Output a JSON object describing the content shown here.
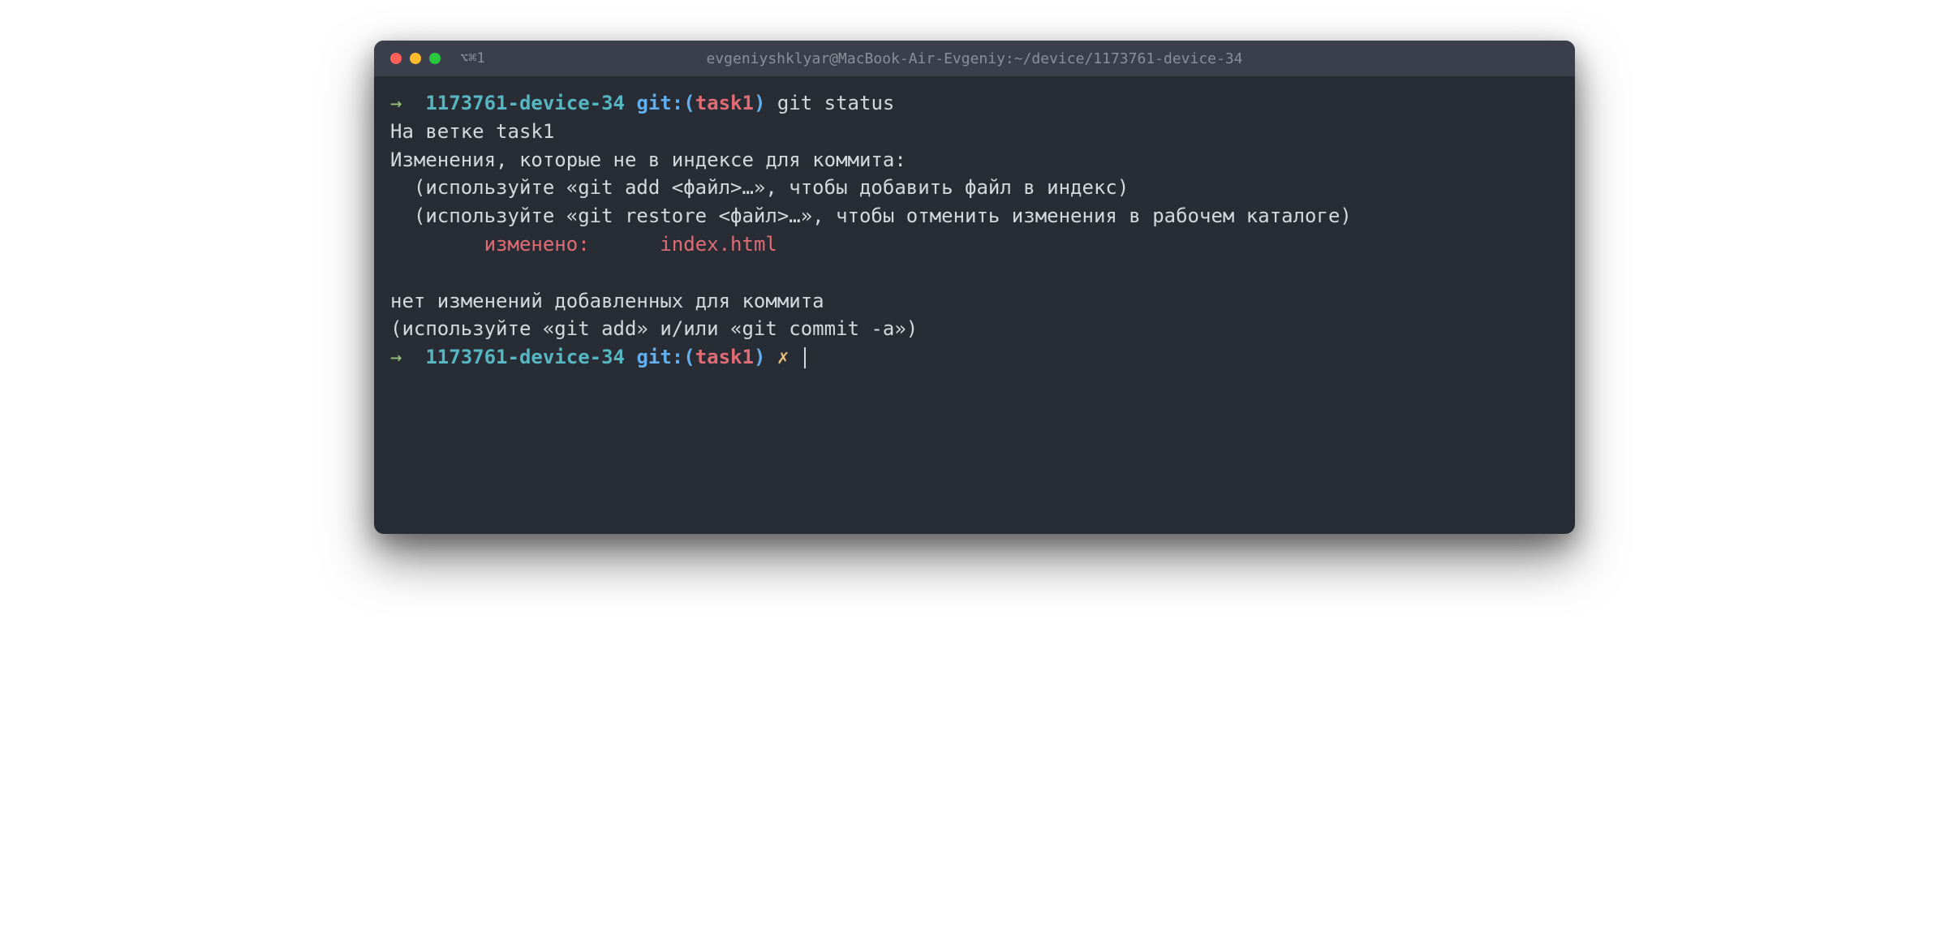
{
  "titlebar": {
    "tab_label": "⌥⌘1",
    "title": "evgeniyshklyar@MacBook-Air-Evgeniy:~/device/1173761-device-34"
  },
  "prompt1": {
    "arrow": "→",
    "dir": "1173761-device-34",
    "git_label": "git:(",
    "branch": "task1",
    "git_close": ")",
    "command": "git status"
  },
  "output": {
    "line1": "На ветке task1",
    "line2": "Изменения, которые не в индексе для коммита:",
    "line3": "  (используйте «git add <файл>…», чтобы добавить файл в индекс)",
    "line4": "  (используйте «git restore <файл>…», чтобы отменить изменения в рабочем каталоге)",
    "changed_label": "        изменено:      ",
    "changed_file": "index.html",
    "line6": "нет изменений добавленных для коммита",
    "line7": "(используйте «git add» и/или «git commit -a»)"
  },
  "prompt2": {
    "arrow": "→",
    "dir": "1173761-device-34",
    "git_label": "git:(",
    "branch": "task1",
    "git_close": ")",
    "dirty": "✗"
  }
}
